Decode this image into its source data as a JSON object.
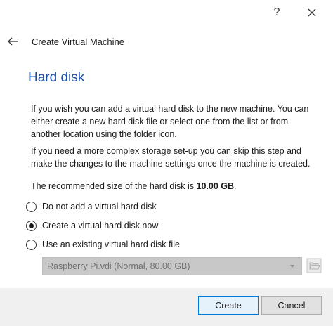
{
  "titlebar": {
    "help_label": "?",
    "close_icon": "close-icon"
  },
  "header": {
    "back_icon": "back-arrow-icon",
    "title": "Create Virtual Machine"
  },
  "page": {
    "section_title": "Hard disk",
    "para1": "If you wish you can add a virtual hard disk to the new machine. You can either create a new hard disk file or select one from the list or from another location using the folder icon.",
    "para2": "If you need a more complex storage set-up you can skip this step and make the changes to the machine settings once the machine is created.",
    "para3_prefix": "The recommended size of the hard disk is ",
    "para3_size": "10.00 GB",
    "para3_suffix": "."
  },
  "options": [
    {
      "label": "Do not add a virtual hard disk",
      "selected": false
    },
    {
      "label": "Create a virtual hard disk now",
      "selected": true
    },
    {
      "label": "Use an existing virtual hard disk file",
      "selected": false
    }
  ],
  "existing_disk": {
    "selected_value": "Raspberry Pi.vdi (Normal, 80.00 GB)",
    "enabled": false,
    "folder_icon": "folder-icon"
  },
  "footer": {
    "create_label": "Create",
    "cancel_label": "Cancel"
  }
}
